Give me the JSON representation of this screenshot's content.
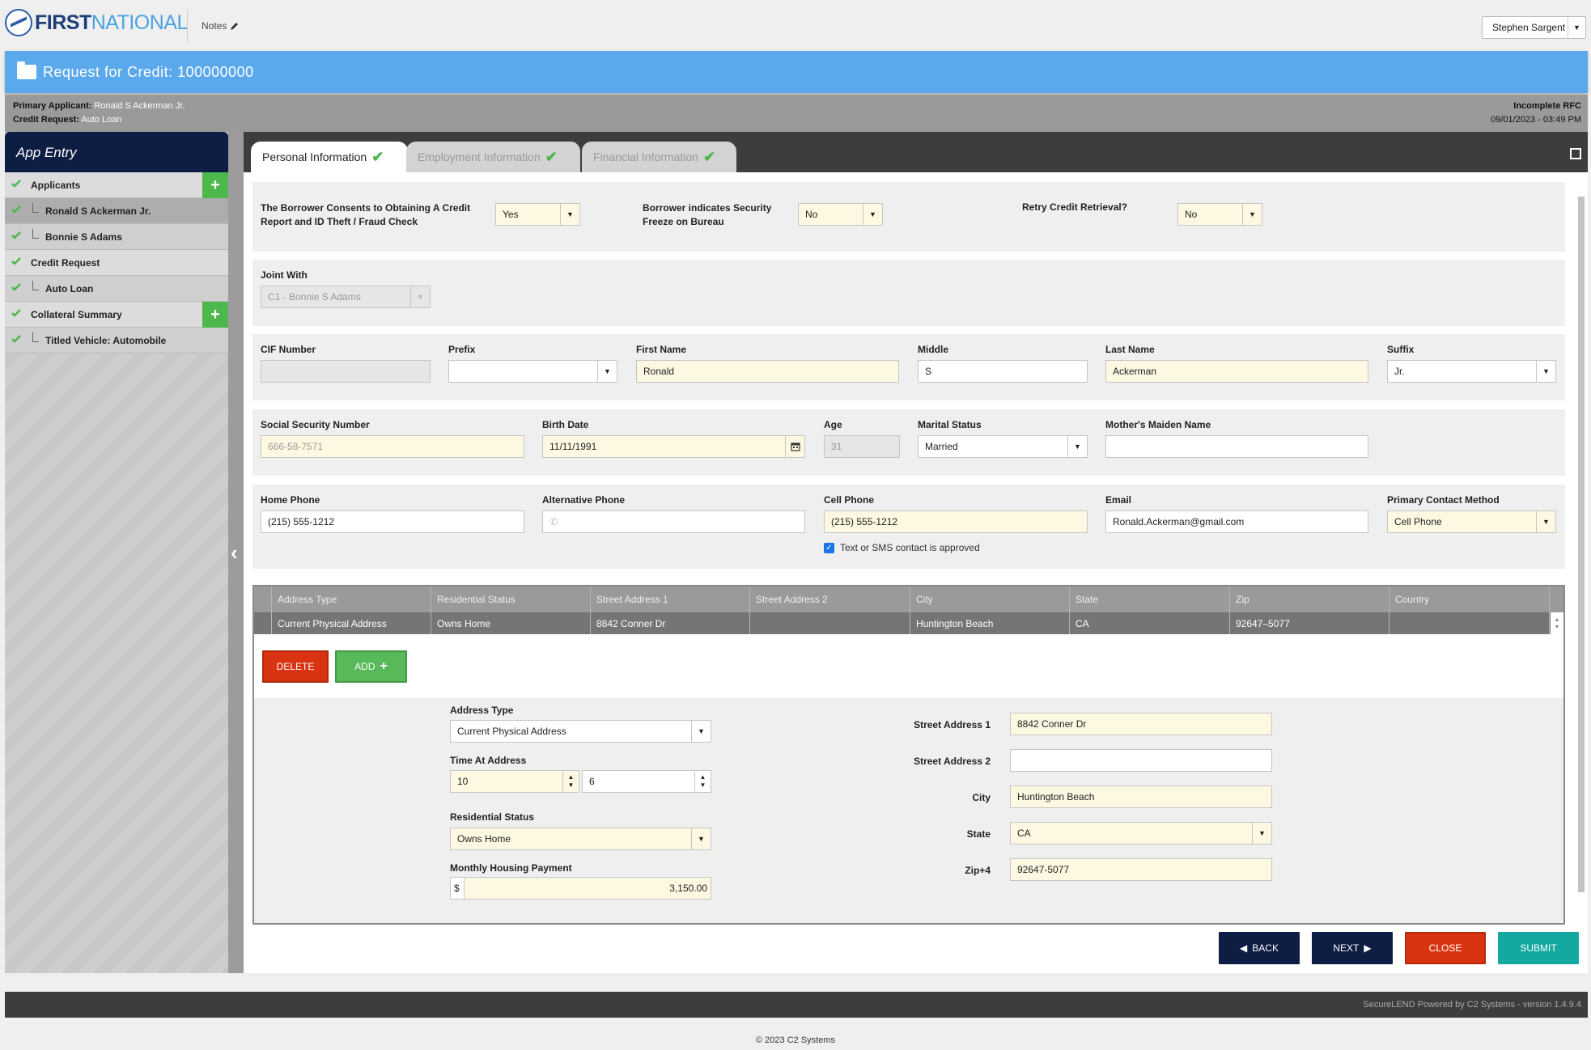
{
  "brand": {
    "first": "FIRST",
    "national": "NATIONAL"
  },
  "topbar": {
    "notes_label": "Notes",
    "user": "Stephen Sargent"
  },
  "header": {
    "title": "Request for Credit: 100000000"
  },
  "app_info": {
    "primary_applicant_label": "Primary Applicant:",
    "primary_applicant": "Ronald S Ackerman Jr.",
    "credit_request_label": "Credit Request:",
    "credit_request": "Auto Loan",
    "status": "Incomplete RFC",
    "datetime": "09/01/2023 - 03:49 PM"
  },
  "sidebar": {
    "title": "App Entry",
    "items": [
      {
        "label": "Applicants"
      },
      {
        "label": "Ronald S Ackerman Jr."
      },
      {
        "label": "Bonnie S Adams"
      },
      {
        "label": "Credit Request"
      },
      {
        "label": "Auto Loan"
      },
      {
        "label": "Collateral Summary"
      },
      {
        "label": "Titled Vehicle: Automobile"
      }
    ]
  },
  "tabs": [
    {
      "label": "Personal Information"
    },
    {
      "label": "Employment Information"
    },
    {
      "label": "Financial Information"
    }
  ],
  "consent": {
    "credit_label": "The Borrower Consents to Obtaining A Credit Report and ID Theft / Fraud Check",
    "credit_value": "Yes",
    "freeze_label": "Borrower indicates Security Freeze on Bureau",
    "freeze_value": "No",
    "retry_label": "Retry Credit Retrieval?",
    "retry_value": "No"
  },
  "joint": {
    "label": "Joint With",
    "value": "C1 - Bonnie S Adams"
  },
  "name": {
    "cif_label": "CIF Number",
    "cif_value": "",
    "prefix_label": "Prefix",
    "prefix_value": "",
    "first_label": "First Name",
    "first_value": "Ronald",
    "middle_label": "Middle",
    "middle_value": "S",
    "last_label": "Last Name",
    "last_value": "Ackerman",
    "suffix_label": "Suffix",
    "suffix_value": "Jr."
  },
  "identity": {
    "ssn_label": "Social Security Number",
    "ssn_value": "666-58-7571",
    "birth_label": "Birth Date",
    "birth_value": "11/11/1991",
    "age_label": "Age",
    "age_value": "31",
    "marital_label": "Marital Status",
    "marital_value": "Married",
    "maiden_label": "Mother's Maiden Name",
    "maiden_value": ""
  },
  "contact": {
    "home_label": "Home Phone",
    "home_value": "(215) 555-1212",
    "alt_label": "Alternative Phone",
    "alt_value": "",
    "cell_label": "Cell Phone",
    "cell_value": "(215) 555-1212",
    "sms_label": "Text or SMS contact is approved",
    "email_label": "Email",
    "email_value": "Ronald.Ackerman@gmail.com",
    "method_label": "Primary Contact Method",
    "method_value": "Cell Phone"
  },
  "address_table": {
    "columns": [
      "Address Type",
      "Residential Status",
      "Street Address 1",
      "Street Address 2",
      "City",
      "State",
      "Zip",
      "Country"
    ],
    "rows": [
      [
        "Current Physical Address",
        "Owns Home",
        "8842 Conner Dr",
        "",
        "Huntington Beach",
        "CA",
        "92647–5077",
        ""
      ]
    ],
    "delete_label": "DELETE",
    "add_label": "ADD"
  },
  "address_form": {
    "type_label": "Address Type",
    "type_value": "Current Physical Address",
    "time_label": "Time At Address",
    "time_years": "10",
    "time_months": "6",
    "res_label": "Residential Status",
    "res_value": "Owns Home",
    "payment_label": "Monthly Housing Payment",
    "payment_currency": "$",
    "payment_value": "3,150.00",
    "street1_label": "Street Address 1",
    "street1_value": "8842 Conner Dr",
    "street2_label": "Street Address 2",
    "street2_value": "",
    "city_label": "City",
    "city_value": "Huntington Beach",
    "state_label": "State",
    "state_value": "CA",
    "zip_label": "Zip+4",
    "zip_value": "92647-5077"
  },
  "actions": {
    "back": "BACK",
    "next": "NEXT",
    "close": "CLOSE",
    "submit": "SUBMIT"
  },
  "footer": {
    "powered": "SecureLEND Powered by C2 Systems - version 1.4.9.4",
    "copyright": "© 2023 C2 Systems"
  },
  "colors": {
    "header": "#5aa9ed",
    "navy": "#0e1d43",
    "green": "#4cb84c",
    "red": "#d93412",
    "teal": "#13a8a0"
  }
}
